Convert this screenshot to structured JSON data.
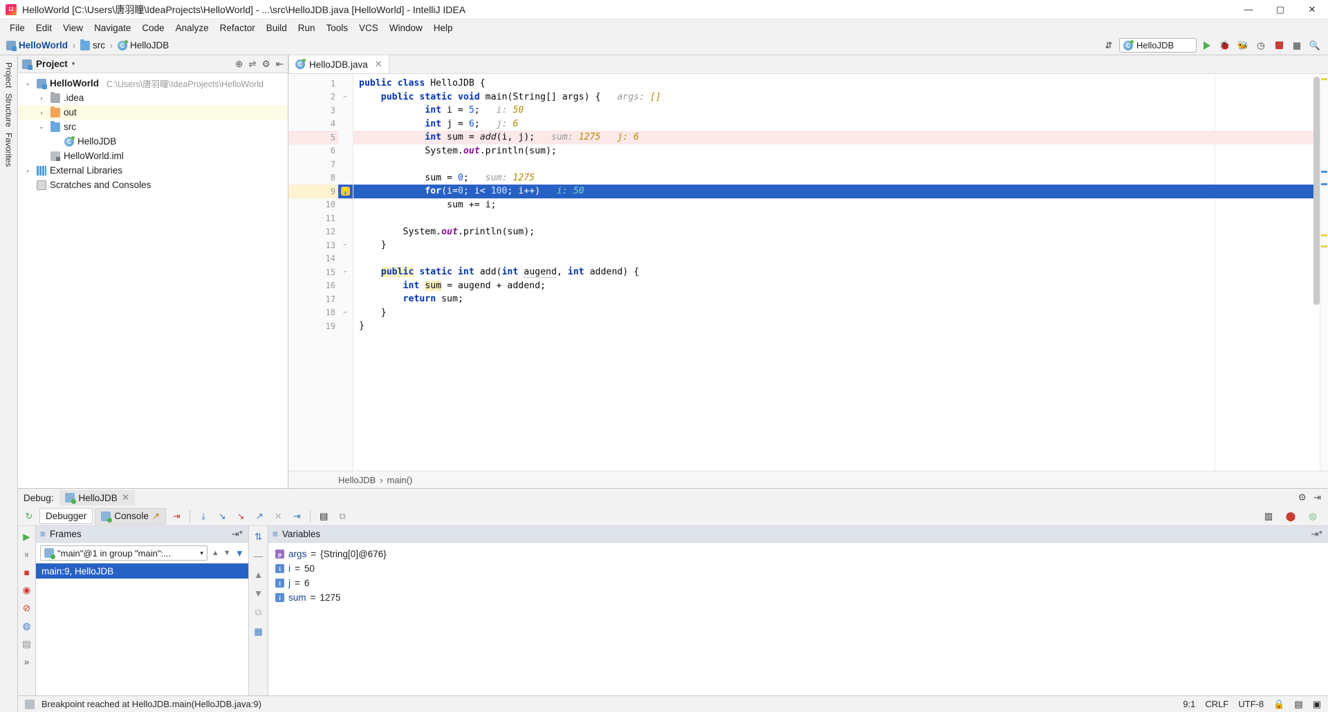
{
  "window": {
    "title": "HelloWorld [C:\\Users\\唐羽瞳\\IdeaProjects\\HelloWorld] - ...\\src\\HelloJDB.java [HelloWorld] - IntelliJ IDEA",
    "minimize": "—",
    "maximize": "▢",
    "close": "✕"
  },
  "menubar": {
    "items": [
      "File",
      "Edit",
      "View",
      "Navigate",
      "Code",
      "Analyze",
      "Refactor",
      "Build",
      "Run",
      "Tools",
      "VCS",
      "Window",
      "Help"
    ]
  },
  "navbar": {
    "breadcrumbs": [
      {
        "label": "HelloWorld",
        "icon": "module-icon"
      },
      {
        "label": "src",
        "icon": "folder-blue-icon"
      },
      {
        "label": "HelloJDB",
        "icon": "java-class-icon"
      }
    ],
    "separator": "›",
    "run_config": "HelloJDB",
    "run_config_icon": "java-class-icon",
    "icons": [
      "sort-icon",
      "run-icon",
      "debug-icon",
      "debug-attach-icon",
      "coverage-icon",
      "stop-icon",
      "layout-icon",
      "search-icon"
    ]
  },
  "project_panel": {
    "title": "Project",
    "dropdown_caret": "▾",
    "header_icons": [
      "locate-icon",
      "collapse-all-icon",
      "gear-icon",
      "hide-icon"
    ],
    "tree": [
      {
        "twisty": "⌄",
        "icon": "module-icon",
        "label": "HelloWorld",
        "bold": true,
        "path": "C:\\Users\\唐羽瞳\\IdeaProjects\\HelloWorld",
        "indent": 0,
        "highlight": false
      },
      {
        "twisty": "›",
        "icon": "folder-gray-icon",
        "label": ".idea",
        "bold": false,
        "path": "",
        "indent": 1,
        "highlight": false
      },
      {
        "twisty": "›",
        "icon": "folder-orange-icon",
        "label": "out",
        "bold": false,
        "path": "",
        "indent": 1,
        "highlight": true
      },
      {
        "twisty": "⌄",
        "icon": "folder-blue-icon",
        "label": "src",
        "bold": false,
        "path": "",
        "indent": 1,
        "highlight": false
      },
      {
        "twisty": "",
        "icon": "java-class-icon",
        "label": "HelloJDB",
        "bold": false,
        "path": "",
        "indent": 2,
        "highlight": false
      },
      {
        "twisty": "",
        "icon": "iml-icon",
        "label": "HelloWorld.iml",
        "bold": false,
        "path": "",
        "indent": 1,
        "highlight": false
      },
      {
        "twisty": "›",
        "icon": "library-icon",
        "label": "External Libraries",
        "bold": false,
        "path": "",
        "indent": 0,
        "highlight": false
      },
      {
        "twisty": "",
        "icon": "scratch-icon",
        "label": "Scratches and Consoles",
        "bold": false,
        "path": "",
        "indent": 0,
        "highlight": false
      }
    ]
  },
  "editor": {
    "tab": {
      "label": "HelloJDB.java",
      "icon": "java-class-icon",
      "close": "✕"
    },
    "breadcrumb_bottom": [
      "HelloJDB",
      "main()"
    ],
    "breadcrumb_sep": "›",
    "lines": [
      {
        "n": "1",
        "indent": 0,
        "text": "public class HelloJDB {",
        "state": "normal",
        "gutter_icon": "run-arrow-icon",
        "fold": "",
        "hint": "",
        "hint_value": ""
      },
      {
        "n": "2",
        "indent": 1,
        "text": "public static void main(String[] args) {",
        "state": "normal",
        "gutter_icon": "run-arrow-icon",
        "fold": "fold-open",
        "hint": "args:",
        "hint_value": "[]"
      },
      {
        "n": "3",
        "indent": 3,
        "text": "int i = 5;",
        "state": "normal",
        "gutter_icon": "",
        "fold": "",
        "hint": "i:",
        "hint_value": "50"
      },
      {
        "n": "4",
        "indent": 3,
        "text": "int j = 6;",
        "state": "normal",
        "gutter_icon": "",
        "fold": "",
        "hint": "j:",
        "hint_value": "6"
      },
      {
        "n": "5",
        "indent": 3,
        "text": "int sum = add(i, j);",
        "state": "breakpoint",
        "gutter_icon": "breakpoint-disabled-icon",
        "fold": "",
        "hint": "sum:",
        "hint_value": "1275   j: 6"
      },
      {
        "n": "6",
        "indent": 3,
        "text": "System.out.println(sum);",
        "state": "normal",
        "gutter_icon": "",
        "fold": "",
        "hint": "",
        "hint_value": ""
      },
      {
        "n": "7",
        "indent": 0,
        "text": "",
        "state": "normal",
        "gutter_icon": "",
        "fold": "",
        "hint": "",
        "hint_value": ""
      },
      {
        "n": "8",
        "indent": 3,
        "text": "sum = 0;",
        "state": "normal",
        "gutter_icon": "",
        "fold": "",
        "hint": "sum:",
        "hint_value": "1275"
      },
      {
        "n": "9",
        "indent": 3,
        "text": "for(i=0; i< 100; i++)",
        "state": "current",
        "gutter_icon": "breakpoint-current-icon",
        "fold": "bulb-icon",
        "hint": "i:",
        "hint_value": "50"
      },
      {
        "n": "10",
        "indent": 4,
        "text": "sum += i;",
        "state": "normal",
        "gutter_icon": "",
        "fold": "",
        "hint": "",
        "hint_value": ""
      },
      {
        "n": "11",
        "indent": 0,
        "text": "",
        "state": "normal",
        "gutter_icon": "",
        "fold": "",
        "hint": "",
        "hint_value": ""
      },
      {
        "n": "12",
        "indent": 2,
        "text": "System.out.println(sum);",
        "state": "normal",
        "gutter_icon": "",
        "fold": "",
        "hint": "",
        "hint_value": ""
      },
      {
        "n": "13",
        "indent": 1,
        "text": "}",
        "state": "normal",
        "gutter_icon": "",
        "fold": "fold-close",
        "hint": "",
        "hint_value": ""
      },
      {
        "n": "14",
        "indent": 0,
        "text": "",
        "state": "normal",
        "gutter_icon": "",
        "fold": "",
        "hint": "",
        "hint_value": ""
      },
      {
        "n": "15",
        "indent": 1,
        "text": "public static int add(int augend, int addend) {",
        "state": "normal",
        "gutter_icon": "",
        "fold": "fold-open",
        "hint": "",
        "hint_value": ""
      },
      {
        "n": "16",
        "indent": 2,
        "text": "int sum = augend + addend;",
        "state": "normal",
        "gutter_icon": "",
        "fold": "",
        "hint": "",
        "hint_value": ""
      },
      {
        "n": "17",
        "indent": 2,
        "text": "return sum;",
        "state": "normal",
        "gutter_icon": "",
        "fold": "",
        "hint": "",
        "hint_value": ""
      },
      {
        "n": "18",
        "indent": 1,
        "text": "}",
        "state": "normal",
        "gutter_icon": "",
        "fold": "fold-close",
        "hint": "",
        "hint_value": ""
      },
      {
        "n": "19",
        "indent": 0,
        "text": "}",
        "state": "normal",
        "gutter_icon": "",
        "fold": "",
        "hint": "",
        "hint_value": ""
      }
    ]
  },
  "debug": {
    "label": "Debug:",
    "session_tab": "HelloJDB",
    "session_close": "✕",
    "tabs": [
      {
        "label": "Debugger",
        "active": true,
        "icon": ""
      },
      {
        "label": "Console",
        "active": false,
        "icon": "console-icon",
        "suffix": "↗"
      }
    ],
    "toolbar_icons": [
      "rerun-icon",
      "step-over-icon",
      "step-into-icon",
      "force-step-into-icon",
      "step-out-icon",
      "drop-frame-icon",
      "run-to-cursor-icon",
      "evaluate-icon",
      "layout-icon"
    ],
    "right_icons": [
      "settings-icon",
      "hide-icon",
      "pin-icon",
      "camera-icon"
    ],
    "frames": {
      "title": "Frames",
      "thread": "\"main\"@1 in group \"main\":...",
      "thread_caret": "▾",
      "nav_up": "▲",
      "nav_down": "▼",
      "filter_icon": "filter-icon",
      "rows": [
        "main:9, HelloJDB"
      ]
    },
    "variables": {
      "title": "Variables",
      "rows": [
        {
          "badge": "p",
          "name": "args",
          "eq": "=",
          "value": "{String[0]@676}"
        },
        {
          "badge": "i",
          "name": "i",
          "eq": "=",
          "value": "50"
        },
        {
          "badge": "i",
          "name": "j",
          "eq": "=",
          "value": "6"
        },
        {
          "badge": "i",
          "name": "sum",
          "eq": "=",
          "value": "1275"
        }
      ]
    }
  },
  "left_strip": {
    "items": [
      "Project",
      "Structure",
      "Favorites"
    ],
    "bottom": "»"
  },
  "statusbar": {
    "message": "Breakpoint reached at HelloJDB.main(HelloJDB.java:9)",
    "caret": "9:1",
    "line_sep": "CRLF",
    "encoding": "UTF-8",
    "icons": [
      "memory-icon",
      "lock-icon",
      "event-log-icon"
    ]
  },
  "colors": {
    "accent_selection": "#2861c4",
    "breakpoint_red": "#d4483f",
    "keyword_blue": "#0033b3",
    "hint_gray": "#9a9a9a",
    "highlight_yellow": "#fcf0bd"
  }
}
